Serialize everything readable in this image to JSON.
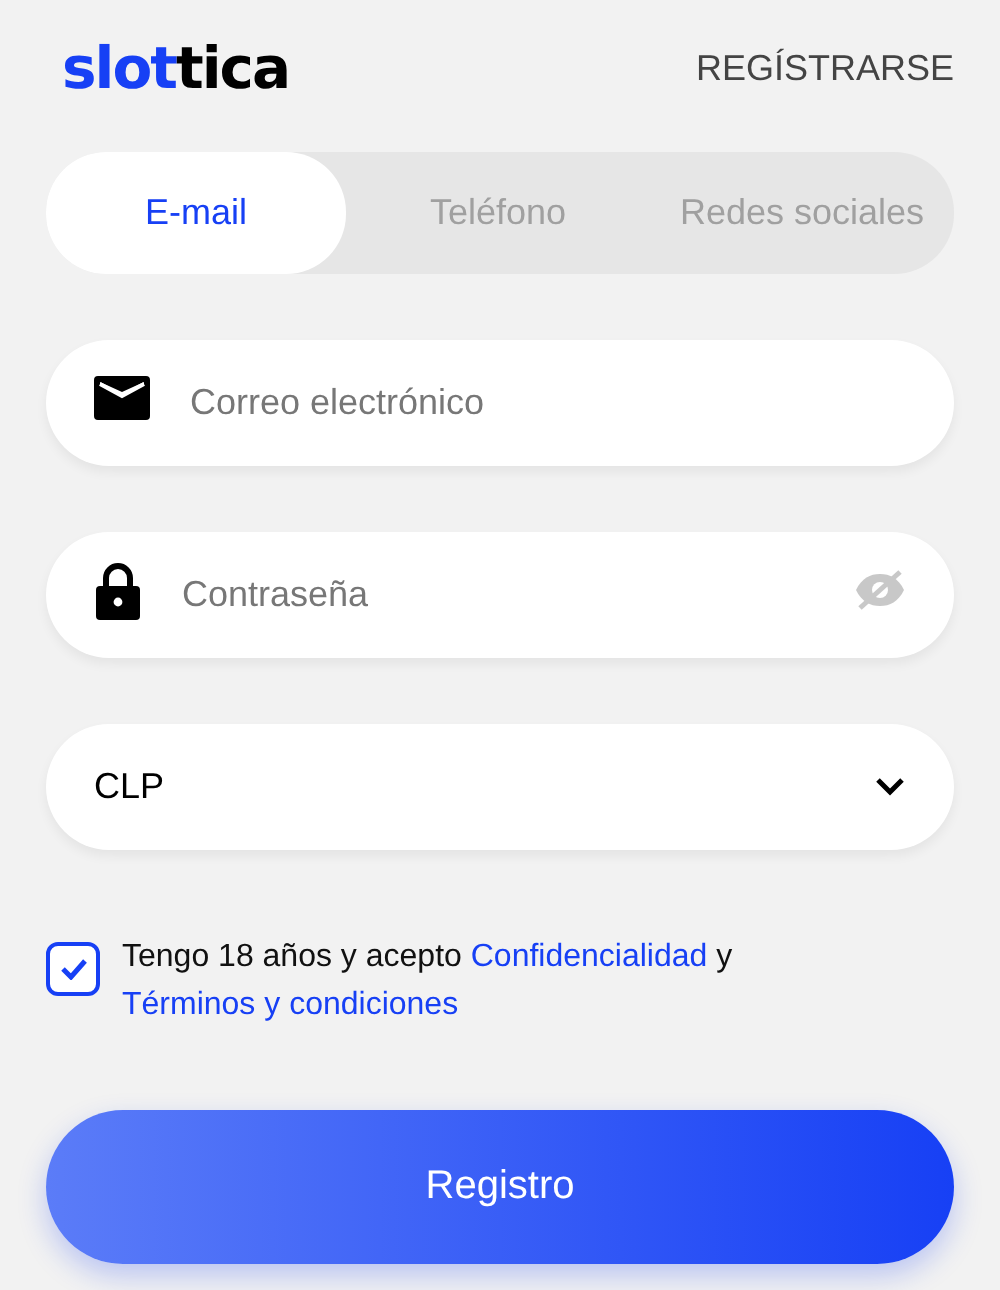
{
  "header": {
    "logo": [
      {
        "text": "slot",
        "color": "#1740f5"
      },
      {
        "text": "tica",
        "color": "#000000"
      }
    ],
    "register_link": "REGÍSTRARSE"
  },
  "tabs": [
    {
      "label": "E-mail",
      "selected": true
    },
    {
      "label": "Teléfono",
      "selected": false
    },
    {
      "label": "Redes sociales",
      "selected": false
    }
  ],
  "fields": [
    {
      "kind": "email",
      "placeholder": "Correo electrónico"
    },
    {
      "kind": "password",
      "placeholder": "Contraseña"
    },
    {
      "kind": "select",
      "value": "CLP"
    }
  ],
  "agreement": {
    "checked": true,
    "parts": [
      {
        "kind": "text",
        "text": "Tengo 18 años y acepto "
      },
      {
        "kind": "link",
        "text": "Confidencialidad"
      },
      {
        "kind": "text",
        "text": " y "
      },
      {
        "kind": "link",
        "text": "Términos y condiciones"
      }
    ]
  },
  "submit": "Registro"
}
